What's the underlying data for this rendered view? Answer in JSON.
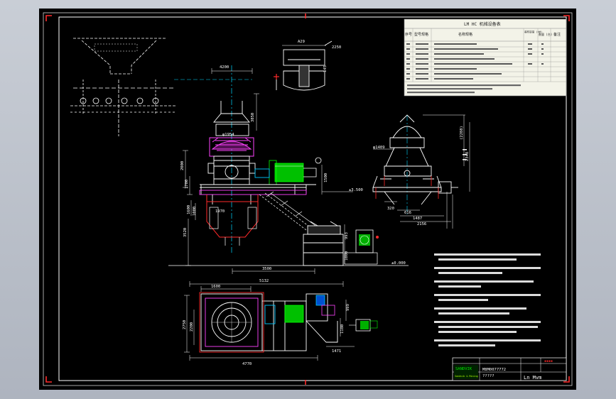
{
  "colors": {
    "background": "#000000",
    "border": "#ffffff",
    "corner_marks": "#ff2a2a",
    "centerline": "#00d8ff",
    "machine": "#ffffff",
    "motor": "#00e000",
    "crusher_head": "#ff44ff",
    "bin_outline": "#ff2a2a",
    "dimension": "#ffffff"
  },
  "title_block": {
    "drawing_name": "Ln Mvm",
    "drawing_number": "M8M0077772",
    "logo_text": "SANDVIK",
    "logo_sub": "Sandvik & Mining",
    "red_mark": "▪▪▪▪"
  },
  "parts_table": {
    "title": "LM HC 机械设备表",
    "headers": [
      "序号",
      "型号规格",
      "名称规格",
      "装机容量 (kW)",
      "数量 (台)",
      "备注"
    ]
  },
  "dimensions": {
    "d_4200": "4200",
    "d_A29": "A29",
    "d_145": "145",
    "d_2250": "2250",
    "d_2200": "2200",
    "d_3850": "3850",
    "d_2000": "2000",
    "d_1700": "1700",
    "d_1500": "1500",
    "d_1600": "1600",
    "d_1000": "1000",
    "d_1970": "1970",
    "d_3520": "3520",
    "d_993": "993",
    "d_1000b": "1000",
    "d_3500": "3500",
    "d_level_3500": "±3.500",
    "d_level_0": "±0.000",
    "d_phi1409": "φ1409",
    "d_2288": "(2288)",
    "d_2348": "2348",
    "d_320": "320",
    "d_616": "616",
    "d_1487": "1487",
    "d_2156": "2156",
    "d_5132": "5132",
    "d_4770": "4770",
    "d_2750": "2750",
    "d_1471": "1471",
    "d_999": "999",
    "d_phi1954": "φ1954"
  }
}
